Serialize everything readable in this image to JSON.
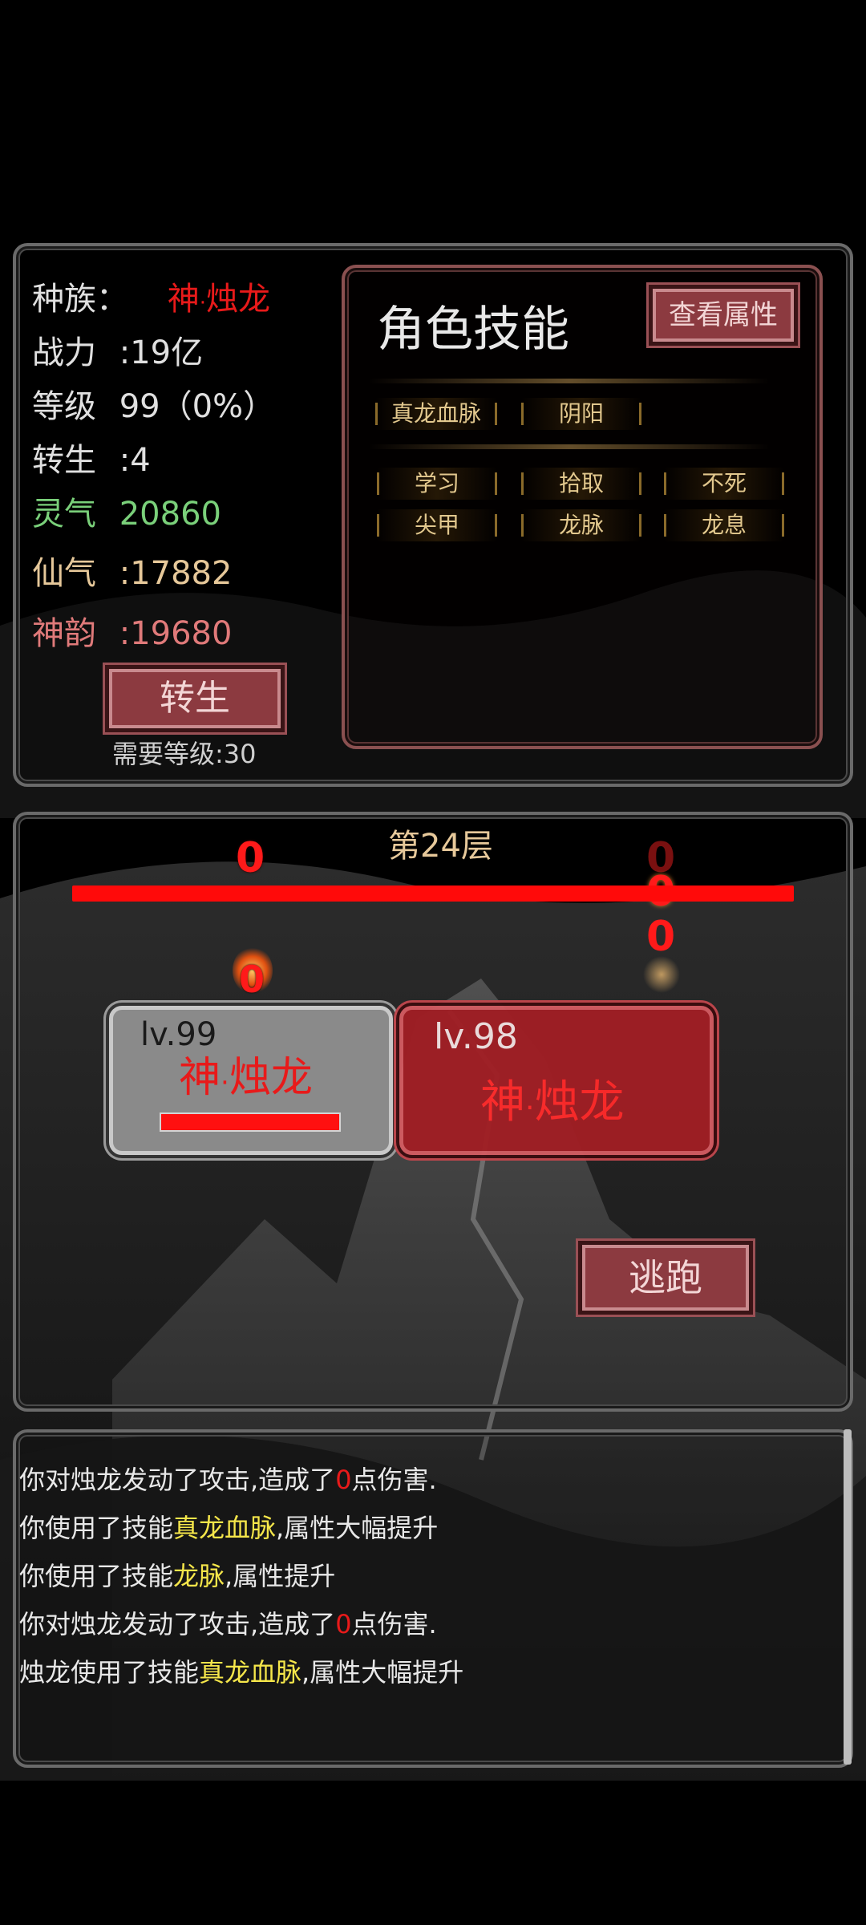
{
  "stats": {
    "race_label": "种族：",
    "race_value_a": "神",
    "race_value_dot": "·",
    "race_value_b": "烛龙",
    "power_label": "战力",
    "power_value": ":19亿",
    "level_label": "等级",
    "level_value": "99（0%）",
    "rebirth_label": "转生",
    "rebirth_value": ":4",
    "lingqi_label": "灵气",
    "lingqi_value": "20860",
    "xianqi_label": "仙气",
    "xianqi_value": ":17882",
    "shenyun_label": "神韵",
    "shenyun_value": ":19680",
    "rebirth_button": "转生",
    "rebirth_requirement": "需要等级:30"
  },
  "skills": {
    "title": "角色技能",
    "view_attributes_button": "查看属性",
    "row1": [
      "真龙血脉",
      "阴阳"
    ],
    "row2": [
      "学习",
      "拾取",
      "不死"
    ],
    "row3": [
      "尖甲",
      "龙脉",
      "龙息"
    ]
  },
  "battle": {
    "floor_label": "第24层",
    "damage_left": "0",
    "damage_right": [
      "0",
      "0",
      "0"
    ],
    "damage_left_icon": "0",
    "player": {
      "level": "lv.99",
      "name_a": "神",
      "name_dot": "·",
      "name_b": "烛龙",
      "hp_fraction": 1.0
    },
    "enemy": {
      "level": "lv.98",
      "name_a": "神",
      "name_dot": "·",
      "name_b": "烛龙"
    },
    "flee_button": "逃跑"
  },
  "log": {
    "line1_a": "你对烛龙发动了攻击,造成了",
    "line1_b": "0",
    "line1_c": "点伤害.",
    "line2_a": "你使用了技能",
    "line2_b": "真龙血脉",
    "line2_c": ",属性大幅提升",
    "line3_a": "你使用了技能",
    "line3_b": "龙脉",
    "line3_c": ",属性提升",
    "line4_a": "你对烛龙发动了攻击,造成了",
    "line4_b": "0",
    "line4_c": "点伤害.",
    "line5_a": "烛龙使用了技能",
    "line5_b": "真龙血脉",
    "line5_c": ",属性大幅提升"
  },
  "colors": {
    "race": "#e81a1a",
    "lingqi": "#7ad07a",
    "xianqi": "#e6c89a",
    "shenyun": "#e07a7a",
    "highlight_skill": "#f5e64a",
    "damage": "#e81a1a"
  }
}
